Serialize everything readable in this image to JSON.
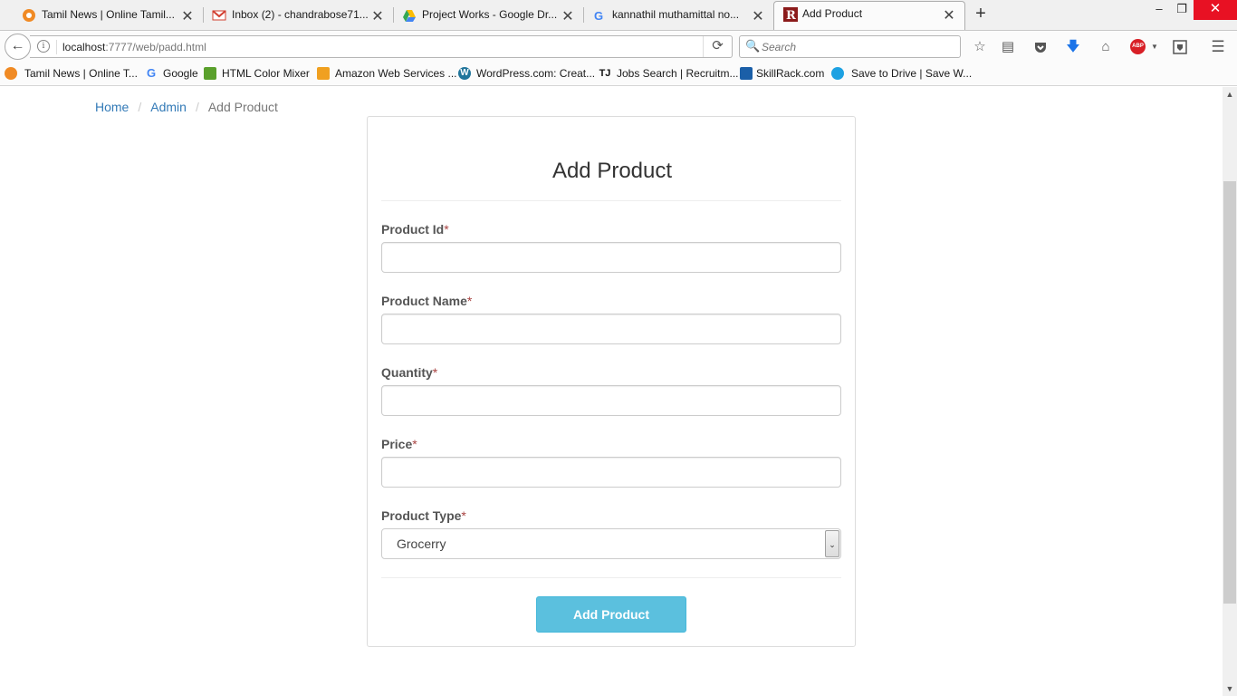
{
  "browser": {
    "tabs": [
      {
        "title": "Tamil News | Online Tamil...",
        "icon": "tamil-news-icon"
      },
      {
        "title": "Inbox (2) - chandrabose71...",
        "icon": "gmail-icon"
      },
      {
        "title": "Project Works - Google Dr...",
        "icon": "google-drive-icon"
      },
      {
        "title": "kannathil muthamittal no...",
        "icon": "google-icon"
      },
      {
        "title": "Add Product",
        "icon": "r-favicon-icon"
      }
    ],
    "url": {
      "host": "localhost",
      "rest": ":7777/web/padd.html"
    },
    "search_placeholder": "Search",
    "abp_label": "ABP",
    "bookmarks": [
      {
        "label": "Tamil News | Online T...",
        "icon": "tamil-news-icon",
        "color": "#f08a24"
      },
      {
        "label": "Google",
        "icon": "google-icon",
        "color": "#4285f4"
      },
      {
        "label": "HTML Color Mixer",
        "icon": "color-mixer-icon",
        "color": "#5aa02c"
      },
      {
        "label": "Amazon Web Services ...",
        "icon": "aws-icon",
        "color": "#f0a020"
      },
      {
        "label": "WordPress.com: Creat...",
        "icon": "wordpress-icon",
        "color": "#21759b"
      },
      {
        "label": "Jobs Search | Recruitm...",
        "icon": "tj-icon",
        "color": "#c01020"
      },
      {
        "label": "SkillRack.com",
        "icon": "skillrack-icon",
        "color": "#1b5fa8"
      },
      {
        "label": "Save to Drive | Save W...",
        "icon": "save-to-drive-icon",
        "color": "#1da1e2"
      }
    ]
  },
  "breadcrumb": {
    "home": "Home",
    "admin": "Admin",
    "current": "Add Product"
  },
  "form": {
    "title": "Add Product",
    "fields": {
      "product_id": {
        "label": "Product Id",
        "value": ""
      },
      "product_name": {
        "label": "Product Name",
        "value": ""
      },
      "quantity": {
        "label": "Quantity",
        "value": ""
      },
      "price": {
        "label": "Price",
        "value": ""
      },
      "product_type": {
        "label": "Product Type",
        "selected": "Grocerry"
      }
    },
    "required_mark": "*",
    "submit_label": "Add Product"
  },
  "colors": {
    "accent": "#5bc0de",
    "link": "#337ab7",
    "required": "#a94442"
  }
}
